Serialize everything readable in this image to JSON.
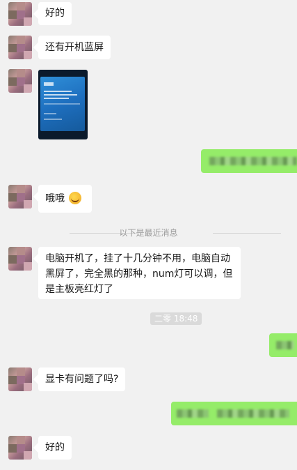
{
  "messages": {
    "m1": {
      "text": "好的"
    },
    "m2": {
      "text": "还有开机蓝屏"
    },
    "m3": {
      "image": "blue-screen-photo"
    },
    "m5": {
      "text": "哦哦",
      "emoji": "laughing-tears-emoji"
    },
    "m6": {
      "text": "电脑开机了，挂了十几分钟不用，电脑自动黑屏了，完全黑的那种，num灯可以调，但是主板亮红灯了"
    },
    "m8": {
      "text": "显卡有问题了吗?"
    },
    "m10": {
      "text": "好的"
    }
  },
  "system": {
    "divider_text": "以下是最近消息",
    "timestamp": "二零 18:48"
  },
  "colors": {
    "background": "#f1f1f1",
    "incoming_bubble": "#ffffff",
    "outgoing_bubble": "#95ec69"
  }
}
